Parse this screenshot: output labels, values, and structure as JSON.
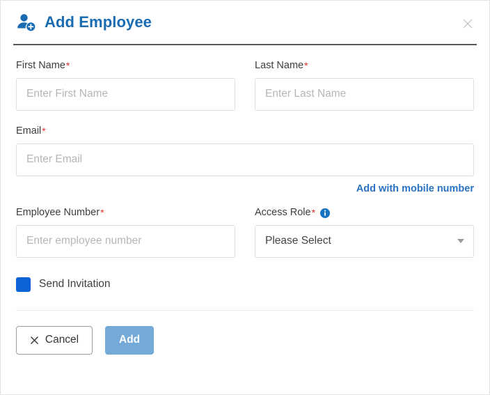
{
  "dialog": {
    "title": "Add Employee",
    "title_icon": "add-user-icon",
    "close_icon": "close-icon",
    "accent_color": "#1a6cb2",
    "link_color": "#2a72c4",
    "required_color": "#e03030",
    "checkbox_color": "#0b63d6",
    "add_button_color": "#74a9d8"
  },
  "fields": {
    "first_name": {
      "label": "First Name",
      "required_marker": "*",
      "placeholder": "Enter First Name",
      "value": ""
    },
    "last_name": {
      "label": "Last Name",
      "required_marker": "*",
      "placeholder": "Enter Last Name",
      "value": ""
    },
    "email": {
      "label": "Email",
      "required_marker": "*",
      "placeholder": "Enter Email",
      "value": ""
    },
    "employee_number": {
      "label": "Employee Number",
      "required_marker": "*",
      "placeholder": "Enter employee number",
      "value": ""
    },
    "access_role": {
      "label": "Access Role",
      "required_marker": "*",
      "info_icon": "info-icon",
      "selected": "Please Select",
      "caret_icon": "chevron-down-icon"
    }
  },
  "links": {
    "add_with_mobile": "Add with mobile number"
  },
  "checkbox": {
    "label": "Send Invitation",
    "checked": true
  },
  "footer": {
    "cancel_label": "Cancel",
    "cancel_icon": "close-x-icon",
    "add_label": "Add"
  }
}
